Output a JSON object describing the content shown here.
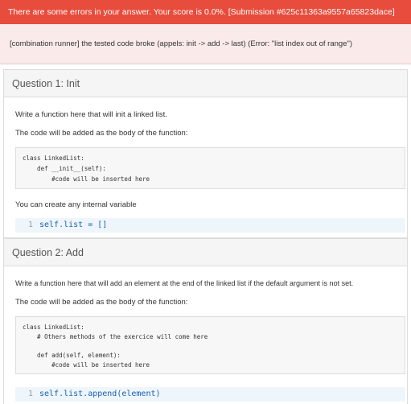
{
  "banner": {
    "error_text": "There are some errors in your answer. Your score is 0.0%. [Submission #625c11363a9557a65823dace]"
  },
  "error_detail": {
    "text": "[combination runner] the tested code broke (appels: init -> add -> last) (Error: \"list index out of range\")"
  },
  "question1": {
    "title": "Question 1: Init",
    "description": "Write a function here that will init a linked list.",
    "body_note": "The code will be added as the body of the function:",
    "code_lines": [
      "class LinkedList:",
      "    def __init__(self):",
      "        #code will be inserted here"
    ],
    "variable_note": "You can create any internal variable",
    "editor": {
      "line_number": "1",
      "code": "self.list = []"
    }
  },
  "question2": {
    "title": "Question 2: Add",
    "description": "Write a function here that will add an element at the end of the linked list if the default argument is not set.",
    "body_note": "The code will be added as the body of the function:",
    "code_lines": [
      "class LinkedList:",
      "    # Others methods of the exercice will come here",
      "",
      "    def add(self, element):",
      "        #code will be inserted here"
    ],
    "editor": {
      "line_number": "1",
      "code": "self.list.append(element)"
    }
  },
  "colors": {
    "error_red": "#e74c3c",
    "error_bg": "#fbeaea",
    "editor_bg": "#eef6fb",
    "code_blue": "#1a5fb4"
  }
}
